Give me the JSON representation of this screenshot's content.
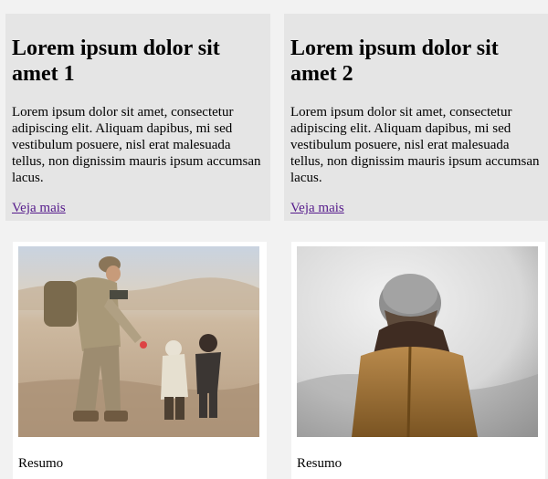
{
  "cards": [
    {
      "title": "Lorem ipsum dolor sit amet 1",
      "text": "Lorem ipsum dolor sit amet, consectetur adipiscing elit. Aliquam dapibus, mi sed vestibulum posuere, nisl erat malesuada tellus, non dignissim mauris ipsum accumsan lacus.",
      "link": "Veja mais"
    },
    {
      "title": "Lorem ipsum dolor sit amet 2",
      "text": "Lorem ipsum dolor sit amet, consectetur adipiscing elit. Aliquam dapibus, mi sed vestibulum posuere, nisl erat malesuada tellus, non dignissim mauris ipsum accumsan lacus.",
      "link": "Veja mais"
    }
  ],
  "image_cards": [
    {
      "caption": "Resumo"
    },
    {
      "caption": "Resumo"
    }
  ],
  "colors": {
    "page_background": "#f2f2f2",
    "card_background": "#e5e5e5",
    "link": "#551a8b",
    "image_card_background": "#ffffff"
  }
}
